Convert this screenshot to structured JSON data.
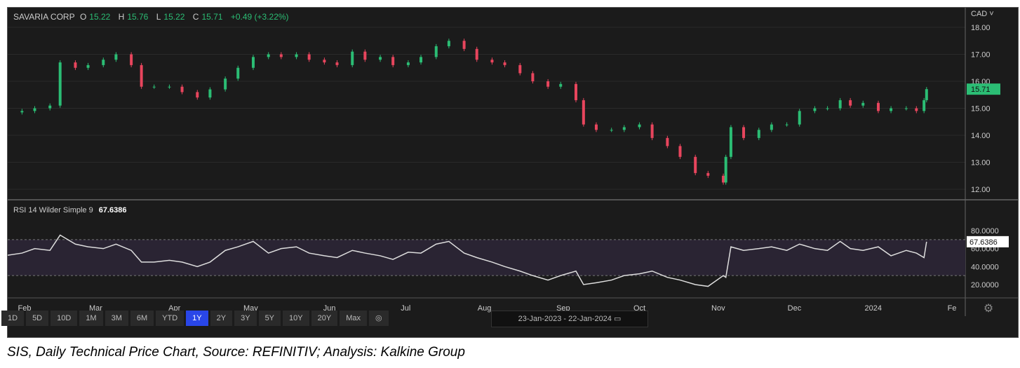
{
  "header": {
    "name": "SAVARIA CORP",
    "o_label": "O",
    "o": "15.22",
    "h_label": "H",
    "h": "15.76",
    "l_label": "L",
    "l": "15.22",
    "c_label": "C",
    "c": "15.71",
    "change": "+0.49 (+3.22%)"
  },
  "currency": "CAD",
  "rsi": {
    "label": "RSI 14 Wilder Simple 9",
    "value": "67.6386"
  },
  "toolbar": {
    "buttons": [
      "1D",
      "5D",
      "10D",
      "1M",
      "3M",
      "6M",
      "YTD",
      "1Y",
      "2Y",
      "3Y",
      "5Y",
      "10Y",
      "20Y",
      "Max"
    ],
    "active": "1Y",
    "date_range": "23-Jan-2023  -  22-Jan-2024"
  },
  "caption": "SIS, Daily Technical Price Chart, Source: REFINITIV; Analysis: Kalkine Group",
  "colors": {
    "up": "#2bbd74",
    "down": "#e8455d",
    "bg": "#1b1b1b"
  },
  "chart_data": {
    "type": "candlestick",
    "title": "SAVARIA CORP",
    "x_unit": "days since 23-Jan-2023",
    "price_ylim": [
      11.8,
      18.3
    ],
    "price_ticks": [
      "18.00",
      "17.00",
      "16.00",
      "15.00",
      "14.00",
      "13.00",
      "12.00"
    ],
    "last_price": "15.71",
    "rsi_ylim": [
      10,
      85
    ],
    "rsi_ticks": [
      "80.0000",
      "60.0000",
      "40.0000",
      "20.0000"
    ],
    "rsi_bands": [
      30,
      70
    ],
    "x_ticks": [
      {
        "label": "Feb",
        "day": 9
      },
      {
        "label": "Mar",
        "day": 37
      },
      {
        "label": "Apr",
        "day": 68
      },
      {
        "label": "May",
        "day": 98
      },
      {
        "label": "Jun",
        "day": 129
      },
      {
        "label": "Jul",
        "day": 159
      },
      {
        "label": "Aug",
        "day": 190
      },
      {
        "label": "Sep",
        "day": 221
      },
      {
        "label": "Oct",
        "day": 251
      },
      {
        "label": "Nov",
        "day": 282
      },
      {
        "label": "Dec",
        "day": 312
      },
      {
        "label": "2024",
        "day": 343
      },
      {
        "label": "Fe",
        "day": 374
      }
    ],
    "days": [
      1,
      8,
      13,
      19,
      23,
      29,
      34,
      40,
      45,
      51,
      55,
      60,
      66,
      71,
      77,
      82,
      88,
      93,
      99,
      105,
      110,
      116,
      121,
      127,
      132,
      138,
      143,
      149,
      154,
      160,
      165,
      171,
      176,
      182,
      187,
      193,
      198,
      204,
      209,
      215,
      220,
      226,
      229,
      234,
      240,
      245,
      251,
      256,
      262,
      267,
      273,
      278,
      284,
      285,
      287,
      292,
      298,
      303,
      309,
      314,
      320,
      325,
      330,
      334,
      339,
      345,
      350,
      356,
      360,
      363,
      364
    ],
    "close": [
      14.85,
      14.9,
      15.0,
      15.1,
      16.7,
      16.5,
      16.6,
      16.8,
      17.0,
      16.6,
      15.8,
      15.8,
      15.8,
      15.6,
      15.4,
      15.7,
      16.1,
      16.5,
      16.9,
      17.0,
      16.9,
      17.0,
      16.8,
      16.7,
      16.6,
      17.1,
      16.8,
      16.9,
      16.6,
      16.7,
      16.9,
      17.3,
      17.5,
      17.2,
      16.8,
      16.7,
      16.6,
      16.3,
      16.0,
      15.8,
      15.9,
      15.3,
      14.4,
      14.2,
      14.2,
      14.3,
      14.4,
      13.9,
      13.6,
      13.2,
      12.6,
      12.5,
      12.25,
      13.2,
      14.3,
      13.9,
      14.2,
      14.4,
      14.4,
      14.9,
      15.0,
      15.0,
      15.3,
      15.1,
      15.2,
      14.9,
      15.0,
      15.0,
      14.9,
      15.3,
      15.71
    ],
    "rsi": [
      52,
      55,
      60,
      58,
      75,
      65,
      62,
      60,
      65,
      58,
      45,
      45,
      47,
      45,
      40,
      45,
      58,
      62,
      68,
      55,
      60,
      62,
      55,
      52,
      50,
      58,
      55,
      52,
      48,
      56,
      55,
      65,
      68,
      55,
      50,
      45,
      40,
      35,
      30,
      25,
      30,
      35,
      20,
      22,
      25,
      30,
      32,
      35,
      28,
      25,
      20,
      18,
      30,
      28,
      62,
      58,
      60,
      62,
      58,
      65,
      60,
      58,
      68,
      60,
      58,
      62,
      52,
      58,
      55,
      50,
      67.64
    ]
  }
}
